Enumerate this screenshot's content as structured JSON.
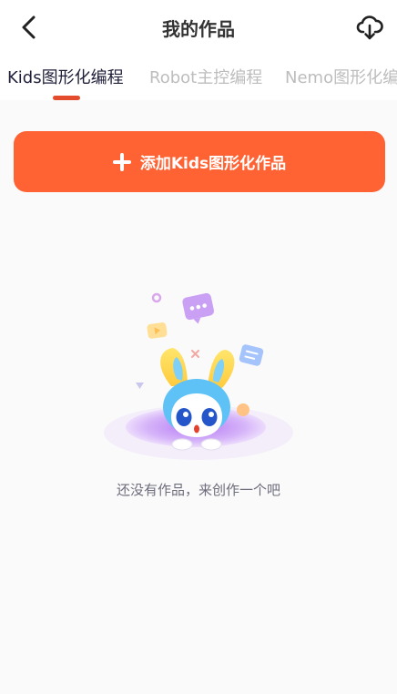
{
  "header": {
    "title": "我的作品",
    "back_icon": "chevron-left-icon",
    "cloud_icon": "cloud-download-icon"
  },
  "tabs": [
    {
      "label": "Kids图形化编程",
      "active": true
    },
    {
      "label": "Robot主控编程",
      "active": false
    },
    {
      "label": "Nemo图形化编程",
      "active": false
    }
  ],
  "add_button": {
    "label": "添加Kids图形化作品",
    "icon": "plus-icon"
  },
  "empty_state": {
    "message": "还没有作品，来创作一个吧",
    "illustration": "mascot-in-portal-illustration"
  },
  "colors": {
    "accent": "#ff6333",
    "tab_indicator": "#e34c2c",
    "title": "#333333",
    "tab_active": "#1f1f3a",
    "tab_inactive": "#bdbdbd",
    "empty_text": "#6d6d7c",
    "background": "#fafafa"
  }
}
